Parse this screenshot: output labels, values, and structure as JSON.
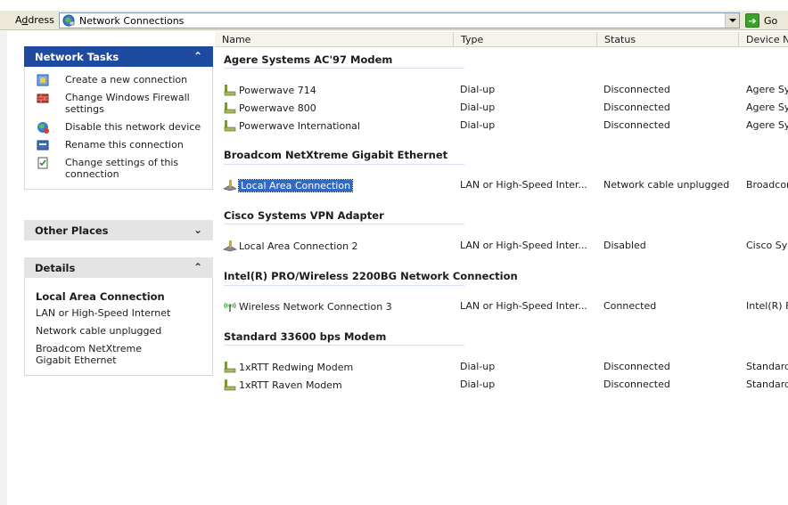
{
  "address": {
    "label_prefix": "A",
    "label_underlined": "d",
    "label_suffix": "dress",
    "value": "Network Connections",
    "go_label": "Go"
  },
  "tasks_panel": {
    "title": "Network Tasks",
    "items": [
      {
        "label": "Create a new connection",
        "icon": "new-connection-icon"
      },
      {
        "label": "Change Windows Firewall settings",
        "icon": "firewall-icon"
      },
      {
        "label": "Disable this network device",
        "icon": "disable-device-icon"
      },
      {
        "label": "Rename this connection",
        "icon": "rename-icon"
      },
      {
        "label": "Change settings of this connection",
        "icon": "settings-icon"
      }
    ]
  },
  "other_places": {
    "title": "Other Places"
  },
  "details": {
    "title": "Details",
    "name": "Local Area Connection",
    "lines": [
      "LAN or High-Speed Internet",
      "Network cable unplugged",
      "Broadcom NetXtreme Gigabit Ethernet"
    ]
  },
  "columns": [
    "Name",
    "Type",
    "Status",
    "Device N"
  ],
  "groups": [
    {
      "title": "Agere Systems AC'97 Modem",
      "rows": [
        {
          "name": "Powerwave 714",
          "type": "Dial-up",
          "status": "Disconnected",
          "device": "Agere Sy",
          "icon": "dialup-icon"
        },
        {
          "name": "Powerwave 800",
          "type": "Dial-up",
          "status": "Disconnected",
          "device": "Agere Sy",
          "icon": "dialup-icon"
        },
        {
          "name": "Powerwave International",
          "type": "Dial-up",
          "status": "Disconnected",
          "device": "Agere Sy",
          "icon": "dialup-icon"
        }
      ]
    },
    {
      "title": "Broadcom NetXtreme Gigabit Ethernet",
      "rows": [
        {
          "name": "Local Area Connection",
          "type": "LAN or High-Speed Inter...",
          "status": "Network cable unplugged",
          "device": "Broadcon",
          "icon": "lan-icon",
          "selected": true
        }
      ]
    },
    {
      "title": "Cisco Systems VPN Adapter",
      "rows": [
        {
          "name": "Local Area Connection 2",
          "type": "LAN or High-Speed Inter...",
          "status": "Disabled",
          "device": "Cisco Sys",
          "icon": "lan-icon"
        }
      ]
    },
    {
      "title": "Intel(R) PRO/Wireless 2200BG Network Connection",
      "rows": [
        {
          "name": "Wireless Network Connection 3",
          "type": "LAN or High-Speed Inter...",
          "status": "Connected",
          "device": "Intel(R) F",
          "icon": "wireless-icon"
        }
      ]
    },
    {
      "title": "Standard 33600 bps Modem",
      "rows": [
        {
          "name": "1xRTT Redwing Modem",
          "type": "Dial-up",
          "status": "Disconnected",
          "device": "Standard",
          "icon": "dialup-icon"
        },
        {
          "name": "1xRTT Raven Modem",
          "type": "Dial-up",
          "status": "Disconnected",
          "device": "Standard",
          "icon": "dialup-icon"
        }
      ]
    }
  ],
  "colors": {
    "selection": "#316ac5",
    "panel_header_active": "#1e4ba0",
    "panel_header": "#e4e4e4"
  }
}
